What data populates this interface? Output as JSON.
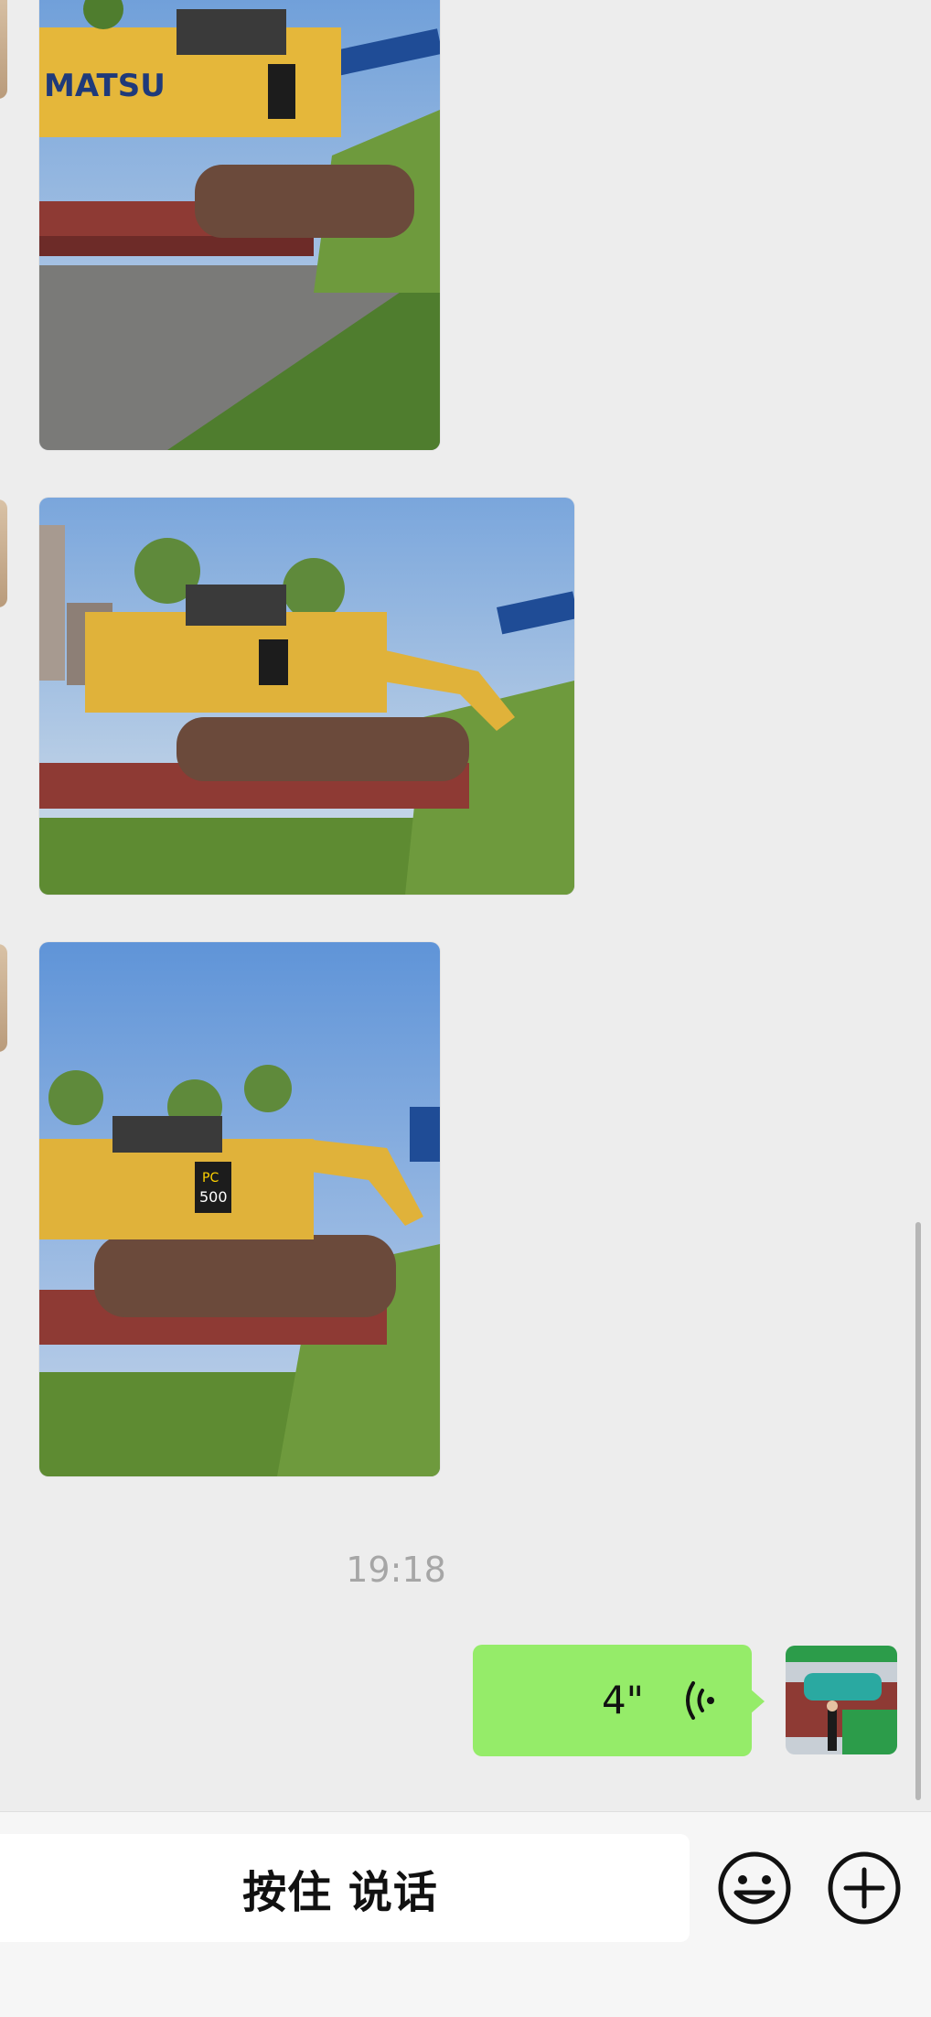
{
  "messages": {
    "timestamp": "19:18",
    "voice": {
      "duration": "4\""
    }
  },
  "input": {
    "hold_to_talk_label": "按住 说话"
  },
  "icons": {
    "voice": "voice-wave-icon",
    "emoji": "emoji-icon",
    "more": "plus-icon"
  },
  "colors": {
    "bubble_self": "#95ec69",
    "background": "#ededed"
  }
}
